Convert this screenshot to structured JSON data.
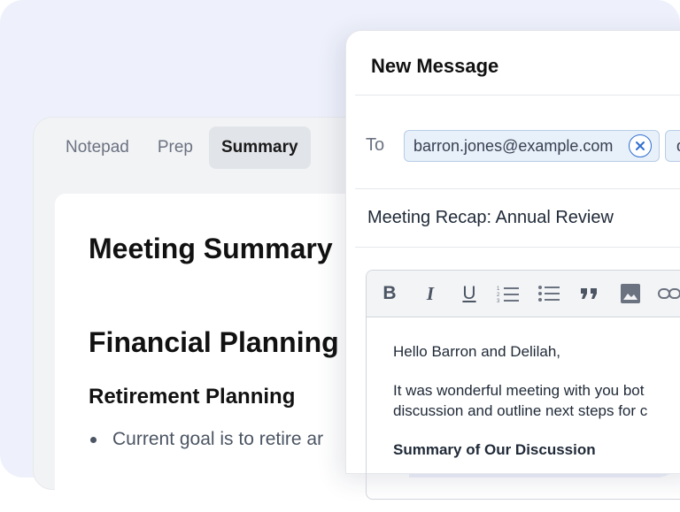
{
  "notes": {
    "tabs": [
      {
        "label": "Notepad",
        "active": false
      },
      {
        "label": "Prep",
        "active": false
      },
      {
        "label": "Summary",
        "active": true
      }
    ],
    "heading": "Meeting Summary",
    "section": "Financial Planning",
    "subsection": "Retirement Planning",
    "bullet": "Current goal is to retire ar"
  },
  "message": {
    "title": "New Message",
    "to_label": "To",
    "recipients": [
      "barron.jones@example.com",
      "d"
    ],
    "subject": "Meeting Recap: Annual Review",
    "toolbar_icons": [
      "bold-icon",
      "italic-icon",
      "underline-icon",
      "numbered-list-icon",
      "bulleted-list-icon",
      "quote-icon",
      "image-icon",
      "link-icon"
    ],
    "toolbar": {
      "bold": "B",
      "italic": "I",
      "underline": "U"
    },
    "body": {
      "greeting": "Hello Barron and Delilah,",
      "line1": "It was wonderful meeting with you bot",
      "line2": "discussion and outline next steps for c",
      "section_title": "Summary of Our Discussion"
    }
  },
  "colors": {
    "background": "#eef1fb",
    "accent": "#2f6fd1",
    "chip": "#e8f0fa"
  }
}
